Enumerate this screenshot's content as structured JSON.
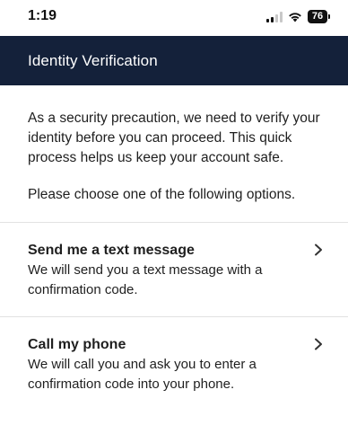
{
  "status_bar": {
    "time": "1:19",
    "battery": "76"
  },
  "header": {
    "title": "Identity Verification"
  },
  "intro": {
    "paragraph1": "As a security precaution, we need to verify your identity before you can proceed. This quick process helps us keep your account safe.",
    "paragraph2": "Please choose one of the following options."
  },
  "options": [
    {
      "title": "Send me a text message",
      "description": "We will send you a text message with a confirmation code.",
      "icon": "chevron-right-icon"
    },
    {
      "title": "Call my phone",
      "description": "We will call you and ask you to enter a confirmation code into your phone.",
      "icon": "chevron-right-icon"
    }
  ],
  "colors": {
    "header_bg": "#14213a",
    "header_text": "#ffffff",
    "divider": "#e2e2e2"
  }
}
